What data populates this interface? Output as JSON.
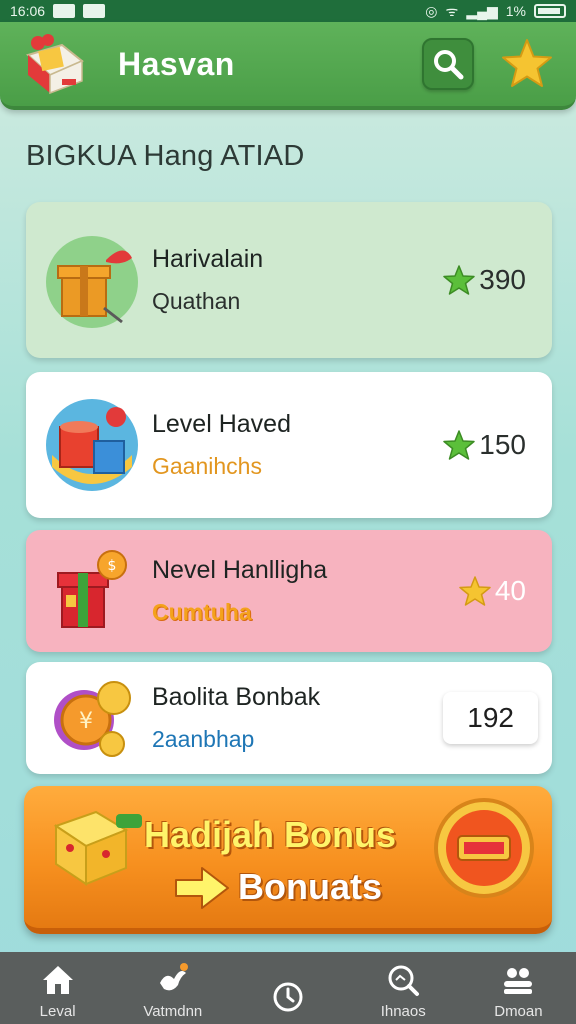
{
  "status_bar": {
    "time": "16:06",
    "battery": "1%"
  },
  "header": {
    "title": "Hasvan"
  },
  "section_title": "BIGKUA Hang ATIAD",
  "cards": [
    {
      "title": "Harivalain",
      "subtitle": "Quathan",
      "subtitle_color": "#2a2f2d",
      "reward": "390",
      "bg": "#cfe9cf"
    },
    {
      "title": "Level Haved",
      "subtitle": "Gaanihchs",
      "subtitle_color": "#e2961f",
      "reward": "150",
      "bg": "#ffffff"
    },
    {
      "title": "Nevel Hanlligha",
      "subtitle": "Cumtuha",
      "subtitle_color": "#f4a21c",
      "reward": "40",
      "bg": "#f7b3bf"
    },
    {
      "title": "Baolita Bonbak",
      "subtitle": "2aanbhap",
      "subtitle_color": "#1e76b5",
      "reward": "192",
      "bg": "#ffffff"
    }
  ],
  "bonus": {
    "title": "Hadijah Bonus",
    "subtitle": "Bonuats"
  },
  "nav": [
    {
      "label": "Leval",
      "icon": "home-icon"
    },
    {
      "label": "Vatmdnn",
      "icon": "bird-icon"
    },
    {
      "label": "",
      "icon": "clock-icon"
    },
    {
      "label": "Ihnaos",
      "icon": "search-icon"
    },
    {
      "label": "Dmoan",
      "icon": "users-icon"
    }
  ],
  "colors": {
    "header_green": "#4a9e47",
    "accent_orange": "#f7901f",
    "star_green": "#5bbf3a",
    "star_gold": "#f5c431"
  }
}
